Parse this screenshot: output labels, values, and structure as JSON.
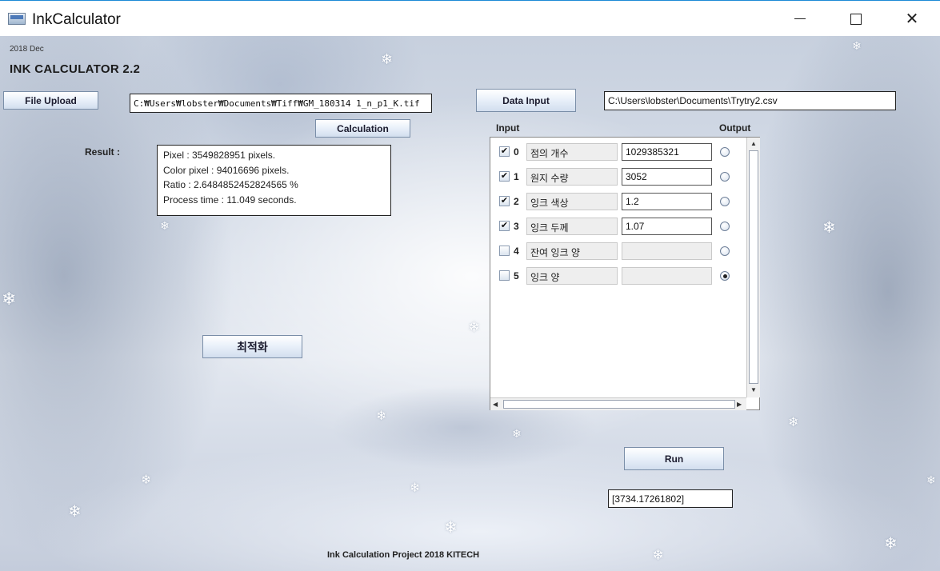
{
  "window": {
    "title": "InkCalculator",
    "controls": {
      "minimize": "minimize",
      "maximize": "maximize",
      "close": "✕"
    }
  },
  "header": {
    "date": "2018 Dec",
    "app_name": "INK CALCULATOR 2.2"
  },
  "file_upload": {
    "button_label": "File Upload",
    "path": "C:₩Users₩lobster₩Documents₩Tiff₩GM_180314 1_n_p1_K.tif"
  },
  "calculation": {
    "button_label": "Calculation",
    "result_label": "Result :",
    "result_lines": [
      "Pixel : 3549828951 pixels.",
      "Color pixel : 94016696 pixels.",
      "Ratio : 2.6484852452824565 %",
      "Process time : 11.049 seconds."
    ]
  },
  "optimize": {
    "button_label": "최적화"
  },
  "data_input": {
    "button_label": "Data Input",
    "path": "C:\\Users\\lobster\\Documents\\Trytry2.csv"
  },
  "table": {
    "input_header": "Input",
    "output_header": "Output",
    "rows": [
      {
        "num": "0",
        "checked": true,
        "name": "점의 개수",
        "value": "1029385321",
        "output_selected": false,
        "value_enabled": true
      },
      {
        "num": "1",
        "checked": true,
        "name": "원지 수량",
        "value": "3052",
        "output_selected": false,
        "value_enabled": true
      },
      {
        "num": "2",
        "checked": true,
        "name": "잉크 색상",
        "value": "1.2",
        "output_selected": false,
        "value_enabled": true
      },
      {
        "num": "3",
        "checked": true,
        "name": "잉크 두께",
        "value": "1.07",
        "output_selected": false,
        "value_enabled": true
      },
      {
        "num": "4",
        "checked": false,
        "name": "잔여 잉크 양",
        "value": "",
        "output_selected": false,
        "value_enabled": false
      },
      {
        "num": "5",
        "checked": false,
        "name": "잉크 양",
        "value": "",
        "output_selected": true,
        "value_enabled": false
      }
    ]
  },
  "run": {
    "button_label": "Run",
    "output": "[3734.17261802]"
  },
  "footer": {
    "text": "Ink Calculation Project 2018 KITECH"
  }
}
